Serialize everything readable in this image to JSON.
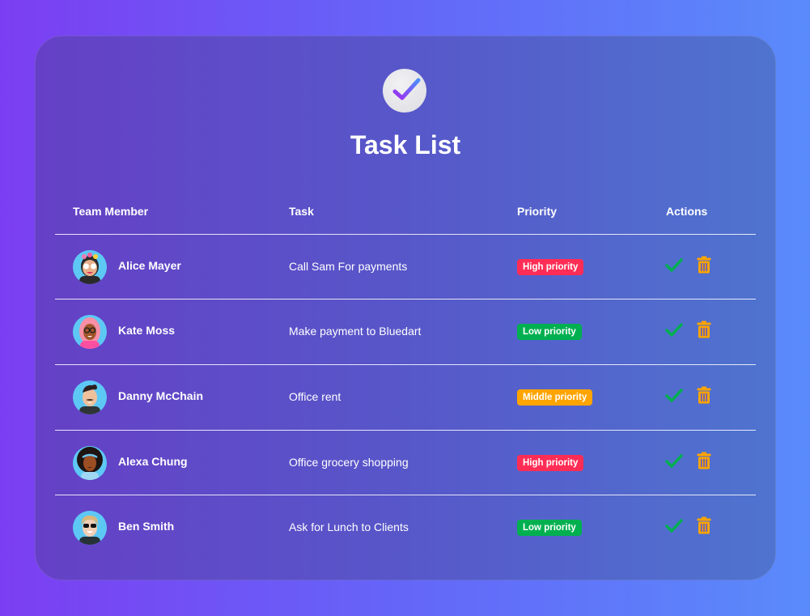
{
  "app": {
    "title": "Task List",
    "logo_icon": "check-circle-icon"
  },
  "table": {
    "headers": [
      "Team Member",
      "Task",
      "Priority",
      "Actions"
    ],
    "rows": [
      {
        "member": "Alice Mayer",
        "task": "Call Sam For payments",
        "priority": "High priority",
        "priority_level": "high"
      },
      {
        "member": "Kate Moss",
        "task": "Make payment to Bluedart",
        "priority": "Low priority",
        "priority_level": "low"
      },
      {
        "member": "Danny McChain",
        "task": "Office rent",
        "priority": "Middle priority",
        "priority_level": "middle"
      },
      {
        "member": "Alexa Chung",
        "task": "Office grocery shopping",
        "priority": "High priority",
        "priority_level": "high"
      },
      {
        "member": "Ben Smith",
        "task": "Ask for Lunch to Clients",
        "priority": "Low priority",
        "priority_level": "low"
      }
    ],
    "actions": {
      "complete_icon": "checkmark-icon",
      "delete_icon": "trash-icon"
    }
  },
  "colors": {
    "high": "#ff2d55",
    "middle": "#ffa400",
    "low": "#00b050",
    "check": "#00b050",
    "trash": "#ffa400"
  }
}
